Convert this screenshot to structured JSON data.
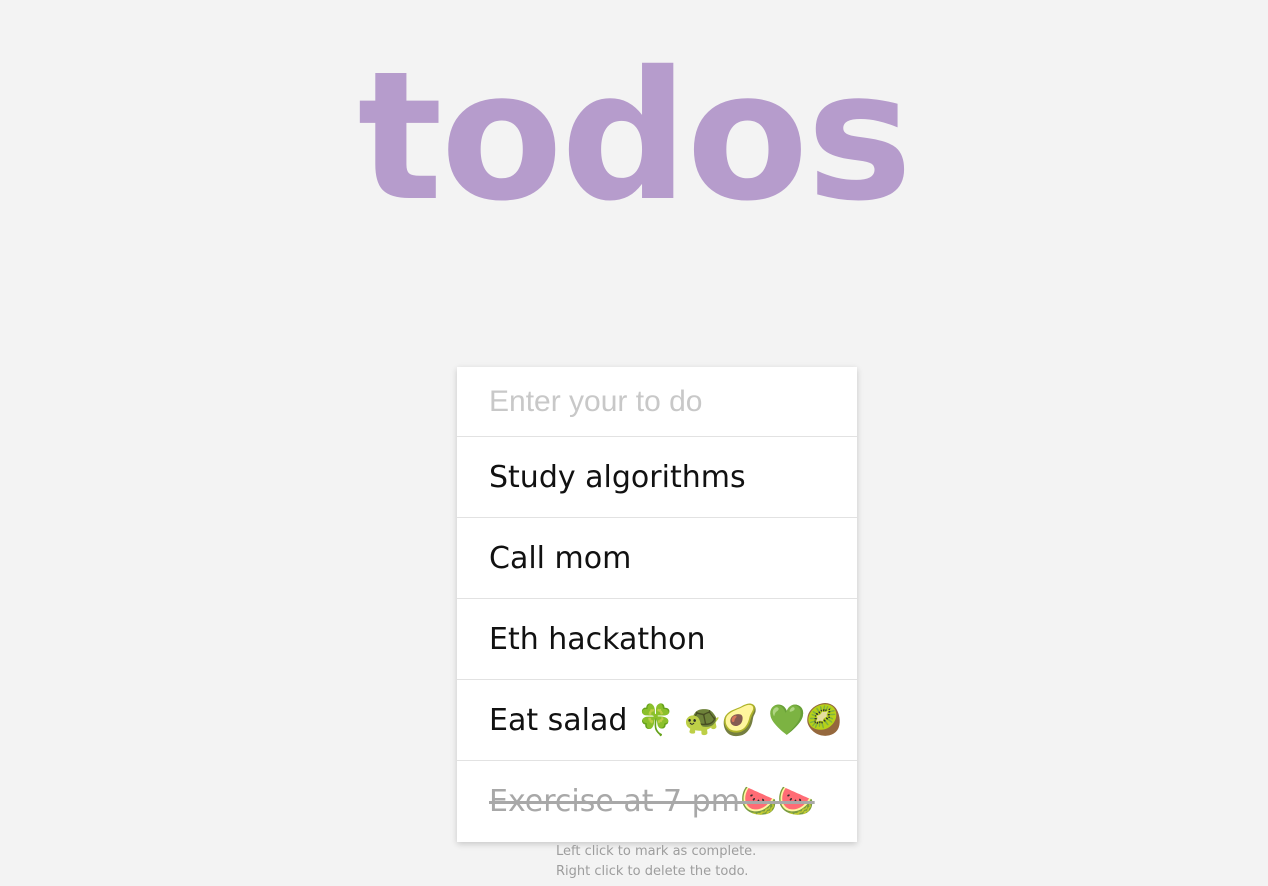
{
  "app": {
    "title": "todos"
  },
  "input": {
    "placeholder": "Enter your to do",
    "value": ""
  },
  "todos": [
    {
      "text": "Study algorithms",
      "completed": false
    },
    {
      "text": "Call mom",
      "completed": false
    },
    {
      "text": "Eth hackathon",
      "completed": false
    },
    {
      "text": "Eat salad 🍀 🐢🥑 💚🥝",
      "completed": false
    },
    {
      "text": "Exercise at 7 pm🍉🍉",
      "completed": true
    }
  ],
  "instructions": {
    "line1": "Left click to mark as complete.",
    "line2": "Right click to delete the todo."
  },
  "colors": {
    "title": "#b69ccc",
    "background": "#f3f3f3",
    "completed_text": "#a8a8a8"
  }
}
